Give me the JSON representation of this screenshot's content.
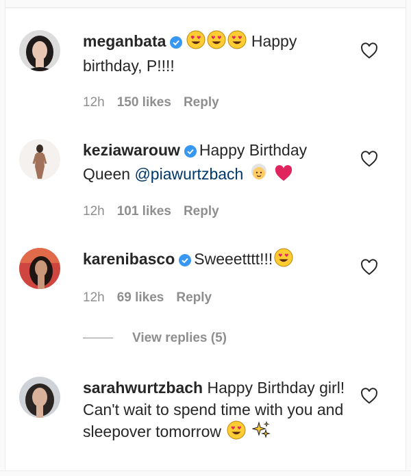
{
  "comments": [
    {
      "username": "meganbata",
      "verified": true,
      "text": "Happy birthday, P!!!!",
      "time": "12h",
      "likes": "150 likes",
      "reply": "Reply"
    },
    {
      "username": "keziawarouw",
      "verified": true,
      "text_before": "Happy Birthday Queen",
      "mention": "@piawurtzbach",
      "time": "12h",
      "likes": "101 likes",
      "reply": "Reply"
    },
    {
      "username": "karenibasco",
      "verified": true,
      "text": "Sweeetttt!!!",
      "time": "12h",
      "likes": "69 likes",
      "reply": "Reply"
    },
    {
      "username": "sarahwurtzbach",
      "verified": false,
      "text": "Happy Birthday girl! Can't wait to spend time with you and sleepover tomorrow"
    }
  ],
  "view_replies": "View replies (5)",
  "colors": {
    "text": "#262626",
    "muted": "#8e8e8e",
    "verified": "#3897f0",
    "mention": "#00376b"
  },
  "icons": [
    "verified-badge-icon",
    "heart-eyes-emoji",
    "old-woman-emoji",
    "red-heart-emoji",
    "sparkles-emoji",
    "heart-outline-icon"
  ]
}
